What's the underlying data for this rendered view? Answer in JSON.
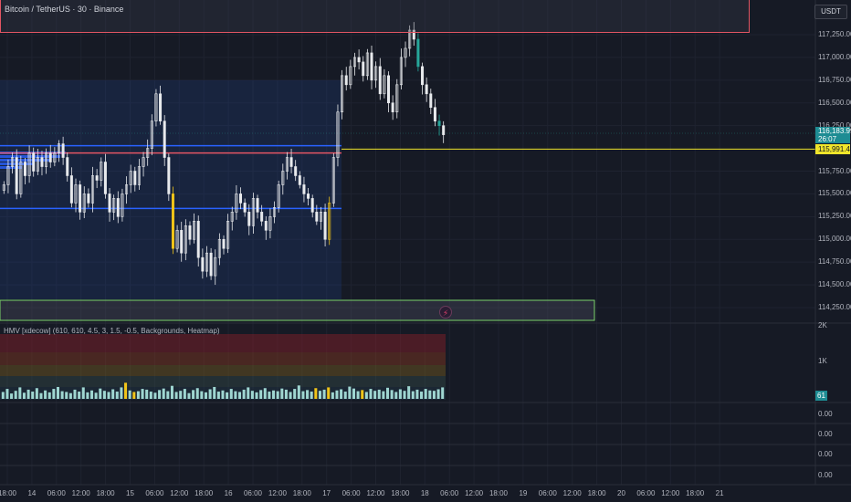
{
  "header": {
    "symbol_title": "Bitcoin / TetherUS · 30 · Binance",
    "currency": "USDT"
  },
  "price_axis": {
    "labels": [
      "117,250.00",
      "117,000.00",
      "116,750.00",
      "116,500.00",
      "116,250.00",
      "115,750.00",
      "115,500.00",
      "115,250.00",
      "115,000.00",
      "114,750.00",
      "114,500.00",
      "114,250.00"
    ],
    "values": [
      117250,
      117000,
      116750,
      116500,
      116250,
      115750,
      115500,
      115250,
      115000,
      114750,
      114500,
      114250
    ],
    "current_price": "116,183.99",
    "countdown": "26:07",
    "level_price": "115,991.45"
  },
  "indicator": {
    "title": "HMV [xdecow] (610, 610, 4.5, 3, 1.5, -0.5, Backgrounds, Heatmap)",
    "axis_labels": [
      "2K",
      "1K"
    ],
    "current_value": "61",
    "flash_icon": "lightning-icon"
  },
  "empty_panes": {
    "labels": [
      "0.00",
      "0.00",
      "0.00",
      "0.00"
    ]
  },
  "time_axis": {
    "labels": [
      "18:00",
      "14",
      "06:00",
      "12:00",
      "18:00",
      "15",
      "06:00",
      "12:00",
      "18:00",
      "16",
      "06:00",
      "12:00",
      "18:00",
      "17",
      "06:00",
      "12:00",
      "18:00",
      "18",
      "06:00",
      "12:00",
      "18:00",
      "19",
      "06:00",
      "12:00",
      "18:00",
      "20",
      "06:00",
      "12:00",
      "18:00",
      "21"
    ]
  },
  "colors": {
    "background": "#161a25",
    "up_candle": "#e8eaed",
    "teal_candle": "#26a69a",
    "volume_bar": "#9fd6d1",
    "highlight_bar": "#f0c419",
    "resistance_box": "#e25563",
    "support_box": "#7bd36b",
    "blue_level": "#2962ff",
    "yellow_level": "#f0e52b"
  },
  "chart_data": {
    "type": "candlestick",
    "y_range": [
      114150,
      117400
    ],
    "levels": {
      "blue_upper": 116030,
      "red": 115950,
      "blue_lower": 115340,
      "yellow": 115991.45
    },
    "close_path": [
      115600,
      115800,
      115900,
      115500,
      115850,
      115700,
      115950,
      115750,
      115900,
      115800,
      115950,
      115850,
      115950,
      116050,
      115900,
      115700,
      115400,
      115600,
      115300,
      115500,
      115400,
      115700,
      115650,
      115850,
      115500,
      115300,
      115450,
      115250,
      115500,
      115600,
      115750,
      115600,
      115800,
      115900,
      116000,
      116300,
      116600,
      116300,
      115900,
      115500,
      114900,
      115100,
      114850,
      115150,
      115000,
      115200,
      114800,
      114650,
      114850,
      114600,
      114800,
      115000,
      114900,
      115200,
      115300,
      115500,
      115400,
      115300,
      115150,
      115450,
      115300,
      115200,
      115100,
      115250,
      115350,
      115600,
      115750,
      115900,
      115800,
      115700,
      115600,
      115500,
      115450,
      115300,
      115200,
      115300,
      115000,
      115400,
      115900,
      116400,
      116800,
      116700,
      116900,
      117000,
      116950,
      116800,
      117050,
      116750,
      116900,
      116600,
      116800,
      116500,
      116400,
      116700,
      117000,
      117100,
      117300,
      117200,
      116900,
      116700,
      116600,
      116450,
      116300,
      116250,
      116150
    ],
    "volume": [
      180,
      260,
      140,
      210,
      300,
      160,
      240,
      190,
      280,
      150,
      220,
      170,
      260,
      310,
      200,
      180,
      150,
      240,
      190,
      300,
      170,
      220,
      160,
      270,
      210,
      180,
      250,
      190,
      300,
      420,
      220,
      180,
      200,
      260,
      240,
      190,
      160,
      230,
      270,
      200,
      340,
      180,
      210,
      260,
      150,
      230,
      280,
      200,
      170,
      250,
      310,
      190,
      220,
      170,
      260,
      200,
      180,
      240,
      300,
      210,
      170,
      230,
      280,
      190,
      220,
      200,
      270,
      240,
      180,
      260,
      350,
      200,
      230,
      190,
      280,
      210,
      240,
      300,
      170,
      220,
      250,
      190,
      320,
      270,
      200,
      230,
      180,
      260,
      210,
      240,
      200,
      290,
      230,
      180,
      250,
      210,
      330,
      200,
      240,
      190,
      260,
      220,
      210,
      250,
      300
    ],
    "highlight_indices": [
      29,
      31,
      74,
      77,
      85
    ]
  }
}
